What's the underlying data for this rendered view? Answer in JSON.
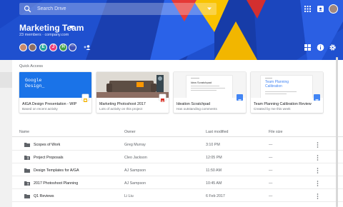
{
  "search": {
    "placeholder": "Search Drive"
  },
  "team": {
    "name": "Marketing Team",
    "members": "23 members",
    "domain": "company.com",
    "members_separator": "·"
  },
  "avatars": [
    {
      "kind": "photo",
      "color": "#c98a6b"
    },
    {
      "kind": "photo",
      "color": "#8d6e63"
    },
    {
      "kind": "letter",
      "letter": "E",
      "color": "#26a69a"
    },
    {
      "kind": "letter",
      "letter": "J",
      "color": "#ec407a"
    },
    {
      "kind": "letter",
      "letter": "H",
      "color": "#43a047"
    },
    {
      "kind": "more",
      "letter": "···",
      "color": "#3f51b5"
    }
  ],
  "quick_access": {
    "label": "Quick Access",
    "cards": [
      {
        "title": "AIGA Design Presentation - WIP",
        "subtitle": "Based on recent activity",
        "thumb_text_1": "Google",
        "thumb_text_2": "Design_",
        "type_icon": "slides-icon",
        "type_color": "#f4b400"
      },
      {
        "title": "Marketing Photoshoot 2017",
        "subtitle": "Lots of activity on this project",
        "type_icon": "image-icon",
        "type_color": "#d93025"
      },
      {
        "title": "Ideation Scratchpad",
        "subtitle": "Has outstanding comments",
        "thumb_doc_title": "Idea Scratchpad",
        "type_icon": "docs-icon",
        "type_color": "#4285f4"
      },
      {
        "title": "Team Planning Calibration Review",
        "subtitle": "Created by me this week",
        "thumb_doc_title": "Team Planning Calibration",
        "type_icon": "docs-icon",
        "type_color": "#4285f4"
      }
    ]
  },
  "list": {
    "columns": {
      "name": "Name",
      "owner": "Owner",
      "modified": "Last modified",
      "size": "File size"
    },
    "rows": [
      {
        "name": "Scopes of Work",
        "owner": "Greg Murray",
        "modified": "3:10 PM",
        "size": "—",
        "shared": false
      },
      {
        "name": "Project Proposals",
        "owner": "Cleo Jackson",
        "modified": "12:05 PM",
        "size": "—",
        "shared": true
      },
      {
        "name": "Design Templates for A/GA",
        "owner": "AJ Sampson",
        "modified": "11:50 AM",
        "size": "—",
        "shared": false
      },
      {
        "name": "2017 Photoshoot Planning",
        "owner": "AJ Sampson",
        "modified": "10:45 AM",
        "size": "—",
        "shared": true
      },
      {
        "name": "Q1 Reviews",
        "owner": "Li Liu",
        "modified": "6 Feb 2017",
        "size": "—",
        "shared": false
      }
    ]
  },
  "colors": {
    "banner": "#1e4fd0",
    "accent": "#4285f4"
  }
}
